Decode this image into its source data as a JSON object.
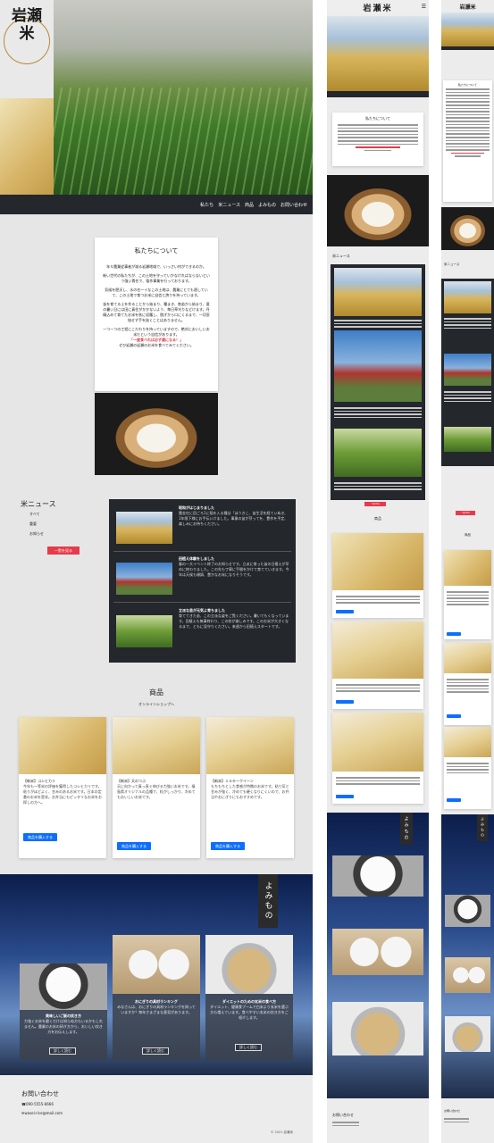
{
  "brand": {
    "logo": "岩瀬米"
  },
  "nav": [
    "私たち",
    "米ニュース",
    "商品",
    "よみもの",
    "お問い合わせ"
  ],
  "about": {
    "title": "私たちについて",
    "p1": "年々農業従事者が減る岩瀬地域で、いっさい何ができるのか。",
    "p2": "新い世代の私たちが、この土地を守っていかなければならないという強い責任で、稲作事業を行っております。",
    "p3": "気候を肥沃し、水の名ーイなこの土地は、農業にとても適していて、この土地で育つお米に自信と誇りを持っています。",
    "p4": "苗を育てる土を作ることから始まり、種まき、育苗から始まり、夏の暑い日には田に真住がかかないよう、毎日草刈りなどけます。丹精込めて育てたお米を秋に収穫し、脱ぎからロにくるまで、一切妥協せず手を抜くことはありません。",
    "p5": "一つ一つの工程にこだわりを持っていますので、絶対においしいお米だという自信があります。",
    "highlight": "「一度食べれば必ず虜になる！」",
    "p6": "ぜひ岩瀬の岩瀬のお米を食べてみてください。"
  },
  "news": {
    "title": "米ニュース",
    "filters": [
      "すべて",
      "重要",
      "お知らせ"
    ],
    "more": "一覧を見る",
    "items": [
      {
        "title": "昭和がはじまりました",
        "body": "農金在に田ごろ1に稲を入る種は「ほうきこ、苗生活を経ていぬき、1年限下様にお手伝いけました。事業の苗が芽ってを、豊作を予定、楽しみにお待ちください。"
      },
      {
        "title": "田植え体験をしました",
        "body": "春の一大イベント終了のお知らせです。立派に育った苗の日植えが早めに終わりました。この先も丁寧に手間をかけて育てていきます。今年は天候も順調、豊かなお米になりそうです。"
      },
      {
        "title": "立派な苗が元気よ育ちました",
        "body": "育ててきた苗、この立派な姿をご覧ください。暑いてもくなっています。田植えも無事終わり、この秋が楽しみです。このお米が大きくなるまで、ともに見守りください。来週から田植えスタートです。"
      }
    ]
  },
  "products": {
    "title": "商品",
    "subtitle": "オンラインショップへ",
    "items": [
      {
        "name": "【新米】コシヒカリ",
        "desc": "今年も一等米の評価を獲得したコシヒカリです。粘りがほどよく、甘みのあるお米です。日本の定番のお米を是非。お弁当にもピッタリなお米をお探しの方へ。",
        "button": "商品を購入する"
      },
      {
        "name": "【新米】天のつぶ",
        "desc": "天に向かって真っ直ぐ伸びる力強いお米です。福島県オリジナルの品種で、粒がしっかり、冷めてもおいしいお米です。",
        "button": "商品を購入する"
      },
      {
        "name": "【新米】ミルキークイーン",
        "desc": "もちもちとした食感が特徴のお米です。粘り気と甘みが強く、冷めても硬くなりにくいので、お弁当やおにぎりにもおすすめです。",
        "button": "商品を購入する"
      }
    ]
  },
  "reading": {
    "title": "よみもの",
    "items": [
      {
        "title": "美味しいご飯の炊き方",
        "body": "力強くお米を磨くだけは知らぬ方もいるかもしれません。農業のお米の研ぎ方から、おいしい炊き方をお伝えします。",
        "button": "詳しく読む"
      },
      {
        "title": "おにぎりの具材ランキング",
        "body": "みなさんは、おにぎりの具材ランキングを知っていますか？毎年さまざまな意見があります。",
        "button": "詳しく読む"
      },
      {
        "title": "ダイエットのための玄米の食べ方",
        "body": "ダイエット、健康食ブームで白米より玄米を選ぶ方も増えています。食べやすい玄米の炊き方をご紹介します。",
        "button": "詳しく読む"
      }
    ]
  },
  "contact": {
    "title": "お問い合わせ",
    "tel": "090-5555-6666",
    "email": "wasei-rice@mail.com"
  },
  "footer": {
    "copyright": "© 2021 岩瀬米"
  },
  "colors": {
    "dark": "#24272c",
    "accent_blue": "#0d6efd",
    "accent_red": "#e53b4b",
    "bg_gray": "#e6e6e6"
  }
}
